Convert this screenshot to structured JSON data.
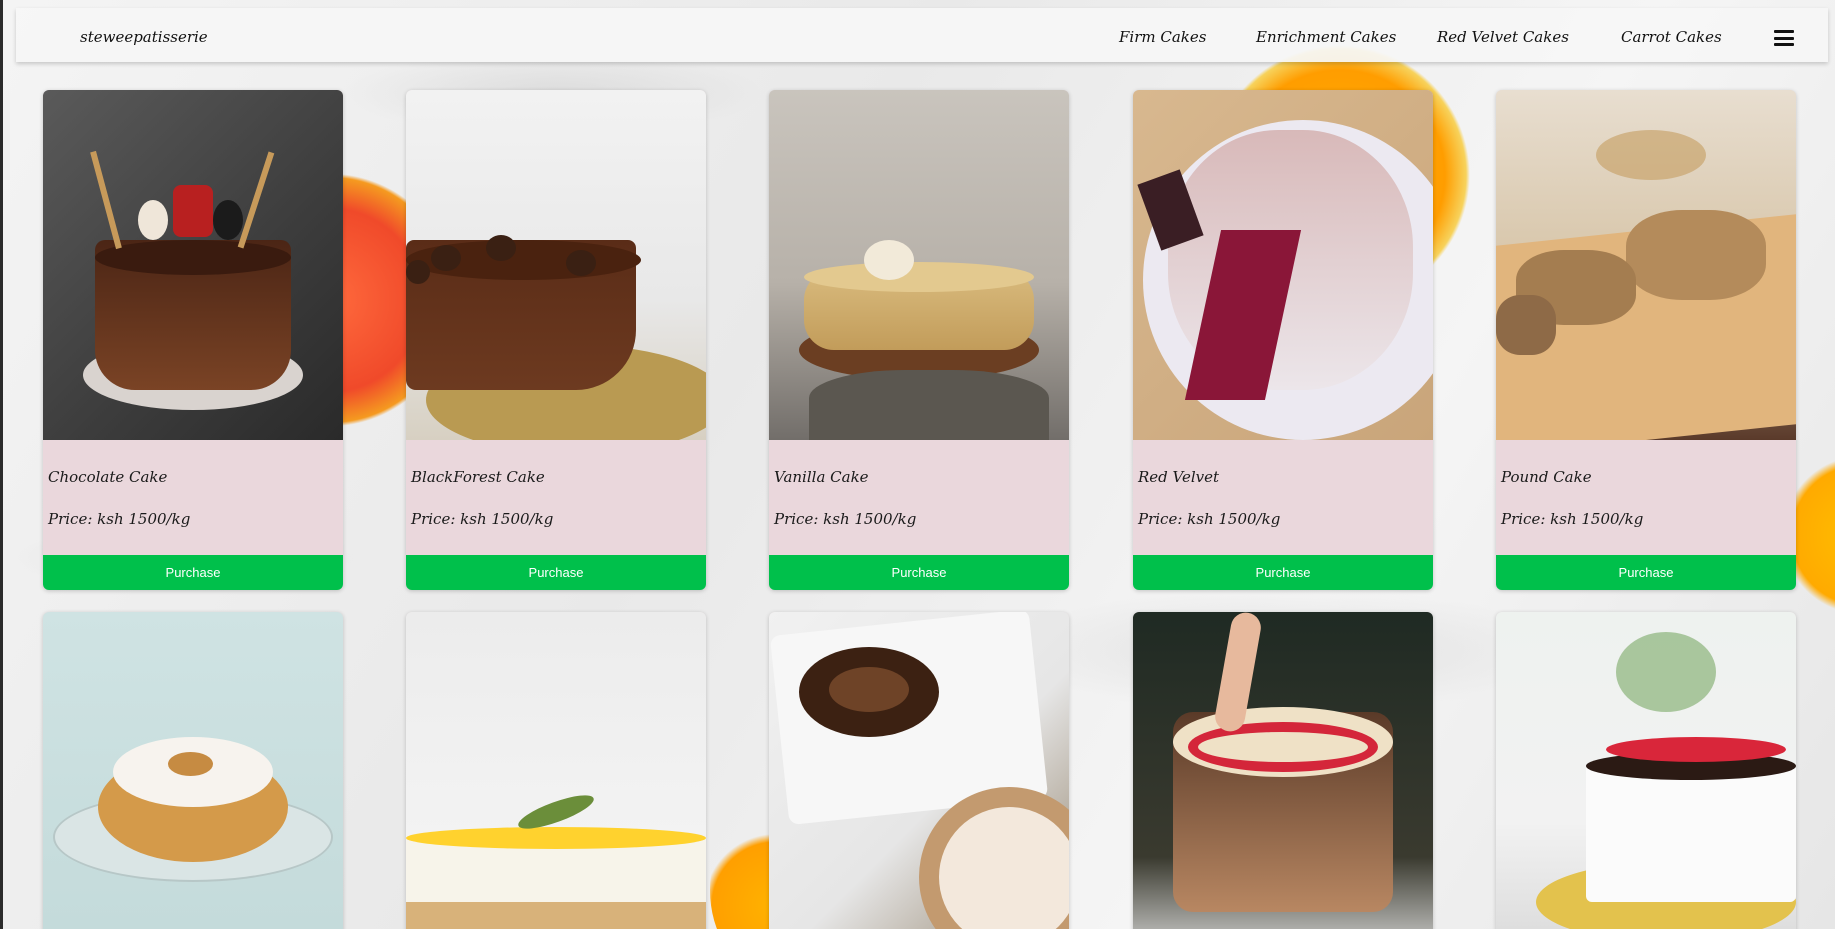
{
  "brand": "steweepatisserie",
  "nav": {
    "links": [
      "Firm Cakes",
      "Enrichment Cakes",
      "Red Velvet Cakes",
      "Carrot Cakes"
    ],
    "menu_icon": "hamburger-menu-icon"
  },
  "cards": [
    {
      "name": "Chocolate Cake",
      "price": "Price: ksh 1500/kg",
      "button": "Purchase"
    },
    {
      "name": "BlackForest Cake",
      "price": "Price: ksh 1500/kg",
      "button": "Purchase"
    },
    {
      "name": "Vanilla Cake",
      "price": "Price: ksh 1500/kg",
      "button": "Purchase"
    },
    {
      "name": "Red Velvet",
      "price": "Price: ksh 1500/kg",
      "button": "Purchase"
    },
    {
      "name": "Pound Cake",
      "price": "Price: ksh 1500/kg",
      "button": "Purchase"
    }
  ],
  "colors": {
    "card_bg": "#ead7dc",
    "button_bg": "#00c04b",
    "button_text": "#ffffff",
    "navbar_bg": "#f6f6f6"
  }
}
